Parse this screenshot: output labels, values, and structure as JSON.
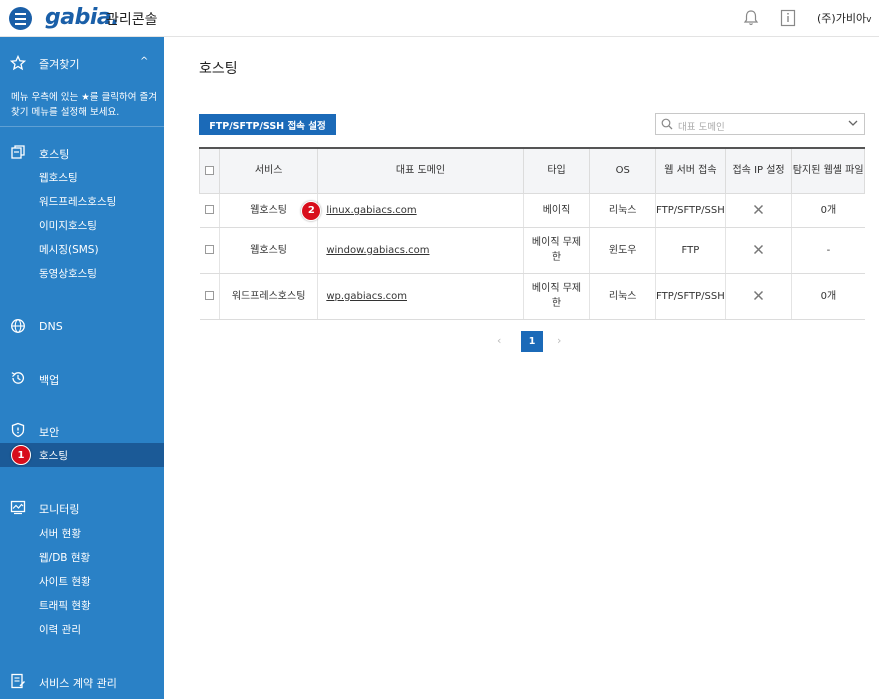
{
  "header": {
    "logo": "gabia.",
    "console_label": "관리콘솔",
    "user_name": "(주)가비아",
    "user_caret": "v"
  },
  "sidebar": {
    "favorites": {
      "title": "즐겨찾기",
      "chevron": "^",
      "description": "메뉴 우측에 있는 ★를 클릭하여 즐겨찾기 메뉴를 설정해 보세요."
    },
    "hosting": {
      "title": "호스팅",
      "items": [
        "웹호스팅",
        "워드프레스호스팅",
        "이미지호스팅",
        "메시징(SMS)",
        "동영상호스팅"
      ]
    },
    "dns": {
      "title": "DNS"
    },
    "backup": {
      "title": "백업"
    },
    "security": {
      "title": "보안",
      "items": [
        "호스팅"
      ]
    },
    "monitoring": {
      "title": "모니터링",
      "items": [
        "서버 현황",
        "웹/DB 현황",
        "사이트 현황",
        "트래픽 현황",
        "이력 관리"
      ]
    },
    "contract": {
      "title": "서비스 계약 관리"
    }
  },
  "main": {
    "title": "호스팅",
    "ftp_button": "FTP/SFTP/SSH 접속 설정",
    "search_placeholder": "대표 도메인",
    "table": {
      "headers": [
        "서비스",
        "대표 도메인",
        "타입",
        "OS",
        "웹 서버 접속",
        "접속 IP 설정",
        "탐지된 웹셸 파일"
      ],
      "rows": [
        {
          "service": "웹호스팅",
          "domain": "linux.gabiacs.com",
          "type": "베이직",
          "os": "리눅스",
          "access": "FTP/SFTP/SSH",
          "ip": "✕",
          "webshell": "0개"
        },
        {
          "service": "웹호스팅",
          "domain": "window.gabiacs.com",
          "type": "베이직 무제한",
          "os": "윈도우",
          "access": "FTP",
          "ip": "✕",
          "webshell": "-"
        },
        {
          "service": "워드프레스호스팅",
          "domain": "wp.gabiacs.com",
          "type": "베이직 무제한",
          "os": "리눅스",
          "access": "FTP/SFTP/SSH",
          "ip": "✕",
          "webshell": "0개"
        }
      ]
    },
    "pagination": {
      "prev": "‹",
      "current": "1",
      "next": "›"
    }
  },
  "annotations": {
    "badge_1": "1",
    "badge_2": "2"
  },
  "colors": {
    "sidebar": "#2a81c6",
    "sidebar_active": "#1b5a97",
    "accent": "#1b6ab8",
    "badge": "#d80d1b"
  }
}
